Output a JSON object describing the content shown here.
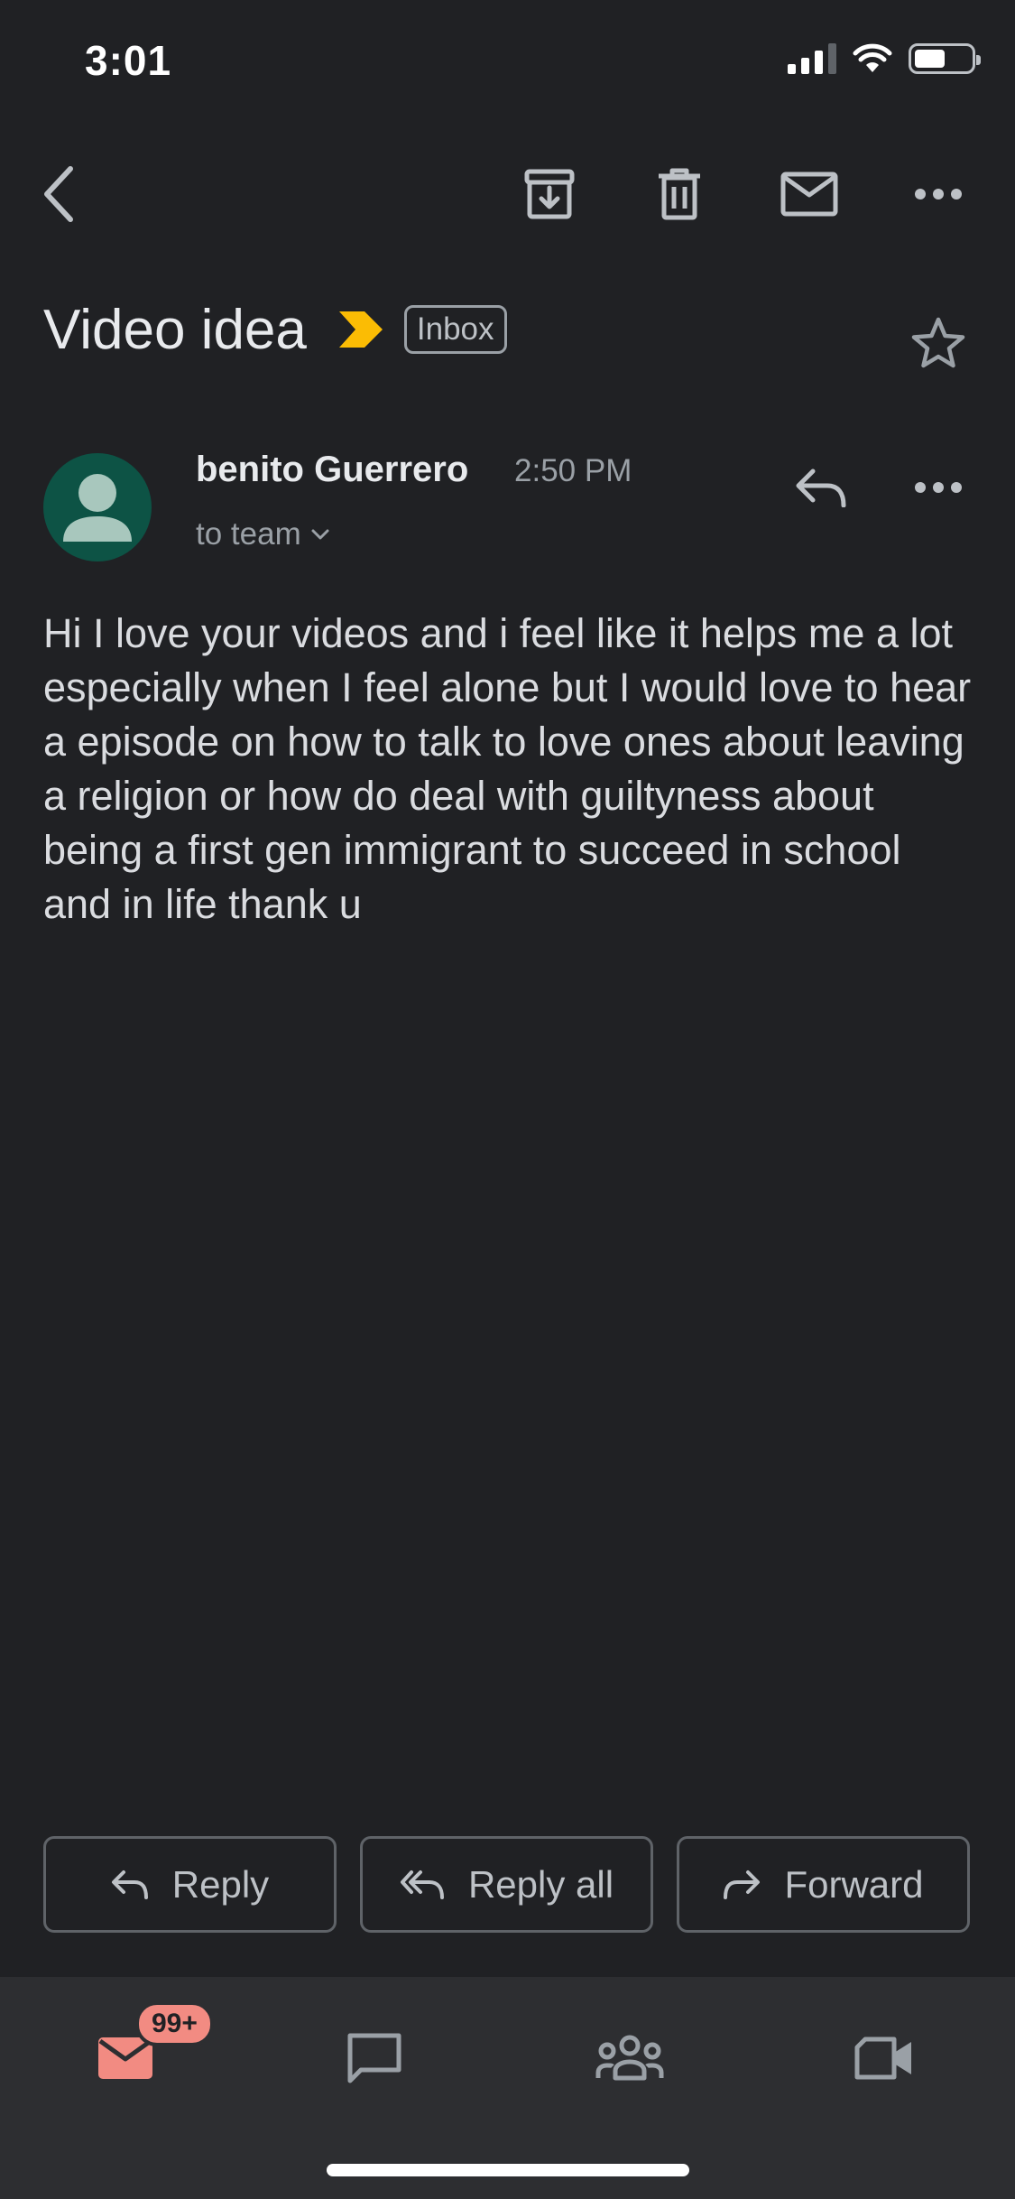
{
  "status_bar": {
    "time": "3:01"
  },
  "toolbar": {
    "back": "chevron-left-icon",
    "archive": "archive-icon",
    "delete": "trash-icon",
    "mark_unread": "envelope-icon",
    "more": "more-horizontal-icon"
  },
  "email": {
    "subject": "Video idea",
    "label": "Inbox",
    "sender_name": "benito Guerrero",
    "time": "2:50 PM",
    "recipients": "to team",
    "body": "Hi I love your videos and i feel like it helps me a lot especially when I feel alone but I would love to hear a episode on how to talk to love ones about leaving a religion or how do deal with guiltyness about being a first gen immigrant to succeed in school and in life thank u"
  },
  "actions": {
    "reply": "Reply",
    "reply_all": "Reply all",
    "forward": "Forward"
  },
  "bottom_nav": {
    "mail_badge": "99+"
  },
  "colors": {
    "background": "#202124",
    "nav_background": "#2d2e31",
    "importance": "#fbbc04",
    "avatar": "#0d5345",
    "badge": "#f28b82"
  }
}
